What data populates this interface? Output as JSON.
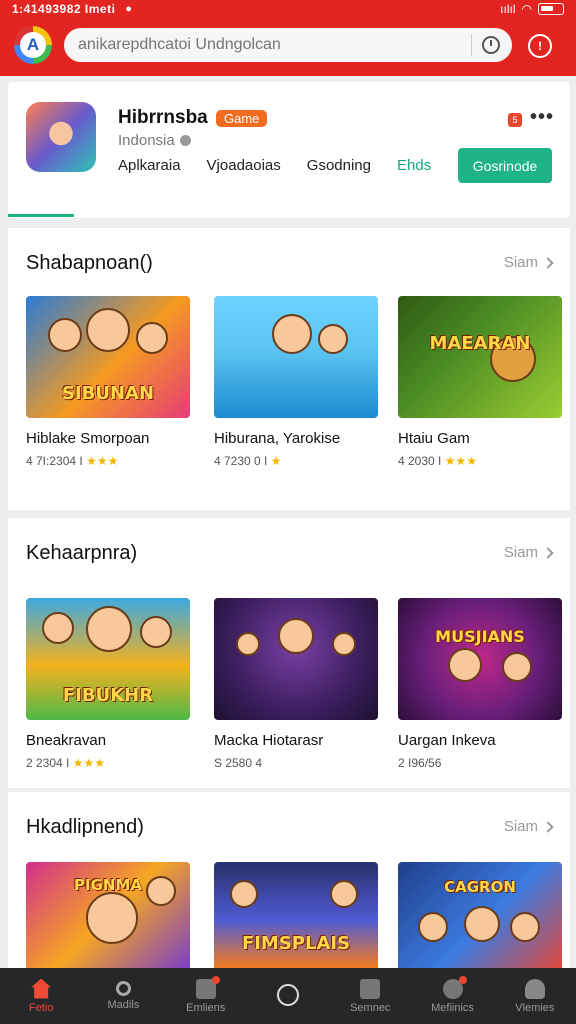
{
  "status": {
    "time": "1:41493982 Imeti",
    "signal": "ıılıl"
  },
  "header": {
    "logo_letter": "A",
    "search_placeholder": "anikarepdhcatoi Undngolcan",
    "scan_glyph": "!"
  },
  "app": {
    "name": "Hibrrnsba",
    "badge": "Game",
    "region": "Indonsia",
    "tabs": [
      "Aplkaraia",
      "Vjoadaoias",
      "Gsodning",
      "Ehds"
    ],
    "install_label": "Gosrinode",
    "notif_count": "5"
  },
  "sections": [
    {
      "title": "Shabapnoan()",
      "more": "Siam",
      "cards": [
        {
          "name": "Hiblake Smorpoan",
          "meta": "4 7I:2304 I",
          "stars": "★★★",
          "thumb_title": "SIBUNAN",
          "colors": [
            "#2b7bd6",
            "#f59a21",
            "#e63b7a"
          ]
        },
        {
          "name": "Hiburana, Yarokise",
          "meta": "4 7230 0 I",
          "stars": "★",
          "thumb_title": "",
          "colors": [
            "#5bc4f0",
            "#1c8ad1",
            "#6fd3ff"
          ]
        },
        {
          "name": "Htaiu Gam",
          "meta": "4 2030 I",
          "stars": "★★★",
          "thumb_title": "MAEARAN",
          "colors": [
            "#4b8c24",
            "#9acd32",
            "#2d5a12"
          ]
        }
      ]
    },
    {
      "title": "Kehaarpnra)",
      "more": "Siam",
      "cards": [
        {
          "name": "Bneakravan",
          "meta": "2 2304 I",
          "stars": "★★★",
          "thumb_title": "FIBUKHR",
          "colors": [
            "#3da8e0",
            "#f3b21f",
            "#4fb848"
          ]
        },
        {
          "name": "Macka Hiotarasr",
          "meta": "S 2580 4",
          "stars": "",
          "thumb_title": "",
          "colors": [
            "#3b1f5e",
            "#7a3fa6",
            "#1d0f30"
          ]
        },
        {
          "name": "Uargan Inkeva",
          "meta": "2 I96/56",
          "stars": "",
          "thumb_title": "MUSJIANS",
          "colors": [
            "#6a1f7a",
            "#c0288a",
            "#2c0f3b"
          ]
        }
      ]
    },
    {
      "title": "Hkadlipnend)",
      "more": "Siam",
      "cards": [
        {
          "name": "",
          "meta": "",
          "stars": "",
          "thumb_title": "PIGNMA",
          "colors": [
            "#d12f8c",
            "#f5a623",
            "#7b3fc4"
          ]
        },
        {
          "name": "",
          "meta": "",
          "stars": "",
          "thumb_title": "FIMSPLAIS",
          "colors": [
            "#29306b",
            "#4f5bd5",
            "#f57c1f"
          ]
        },
        {
          "name": "",
          "meta": "",
          "stars": "",
          "thumb_title": "CAGRON",
          "colors": [
            "#1f3f8a",
            "#3c7be0",
            "#e04a3c"
          ]
        }
      ]
    }
  ],
  "bottom_nav": [
    "Fetio",
    "Madils",
    "Emliens",
    "",
    "Semnec",
    "Mefiinics",
    "Vlemies"
  ]
}
